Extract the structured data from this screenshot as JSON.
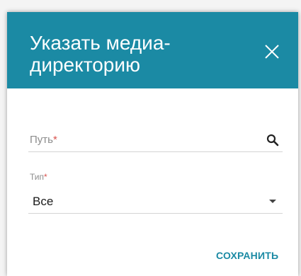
{
  "dialog": {
    "title": "Указать медиа-директорию",
    "close_icon": "close-icon",
    "header_color": "#1b8aa4",
    "path_field": {
      "label": "Путь",
      "required_mark": "*",
      "icon": "search-icon"
    },
    "type_field": {
      "label": "Тип",
      "required_mark": "*",
      "value": "Все",
      "icon": "caret-down-icon"
    },
    "save_label": "СОХРАНИТЬ"
  }
}
